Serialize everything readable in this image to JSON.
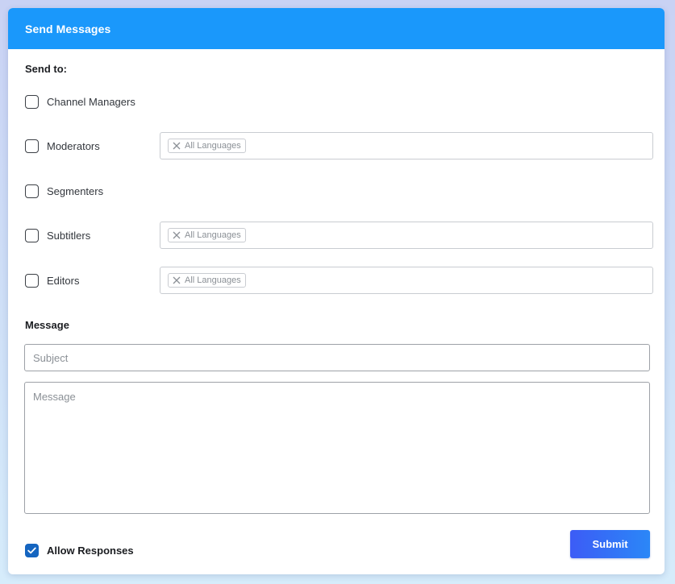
{
  "dialog": {
    "title": "Send Messages"
  },
  "send_to": {
    "label": "Send to:",
    "recipients": [
      {
        "label": "Channel Managers",
        "checked": false,
        "has_language_filter": false
      },
      {
        "label": "Moderators",
        "checked": false,
        "has_language_filter": true,
        "language_tag": "All Languages"
      },
      {
        "label": "Segmenters",
        "checked": false,
        "has_language_filter": false
      },
      {
        "label": "Subtitlers",
        "checked": false,
        "has_language_filter": true,
        "language_tag": "All Languages"
      },
      {
        "label": "Editors",
        "checked": false,
        "has_language_filter": true,
        "language_tag": "All Languages"
      }
    ]
  },
  "message": {
    "label": "Message",
    "subject_placeholder": "Subject",
    "subject_value": "",
    "body_placeholder": "Message",
    "body_value": ""
  },
  "footer": {
    "allow_responses_label": "Allow Responses",
    "allow_responses_checked": true,
    "submit_label": "Submit"
  },
  "icons": {
    "tag_remove": "close-icon",
    "checkbox_check": "checkmark-icon"
  },
  "colors": {
    "header": "#1a98fb",
    "submit_start": "#3c5cf6",
    "submit_end": "#2b87f7",
    "checkbox_checked": "#1565c0"
  }
}
